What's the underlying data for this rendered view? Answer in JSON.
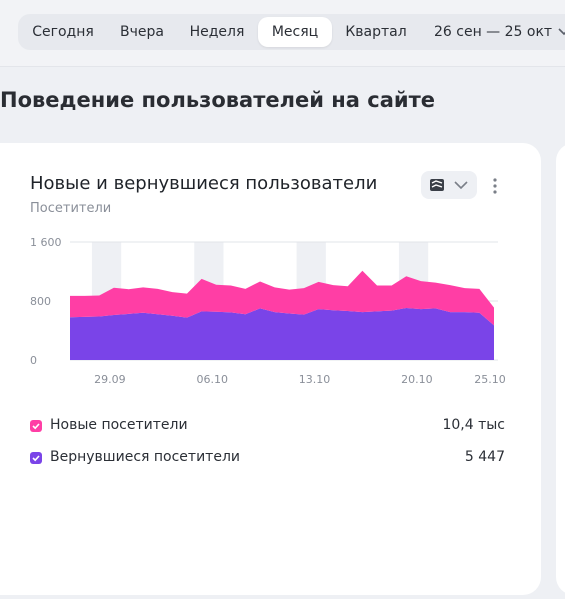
{
  "periods": [
    {
      "label": "Сегодня",
      "active": false
    },
    {
      "label": "Вчера",
      "active": false
    },
    {
      "label": "Неделя",
      "active": false
    },
    {
      "label": "Месяц",
      "active": true
    },
    {
      "label": "Квартал",
      "active": false
    }
  ],
  "date_range": "26 сен — 25 окт",
  "section_title": "Поведение пользователей на сайте",
  "card": {
    "title": "Новые и вернувшиеся пользователи",
    "subtitle": "Посетители",
    "chart_type_icon": "stacked-area-icon",
    "more_icon": "more-vertical-icon"
  },
  "legend": [
    {
      "label": "Новые посетители",
      "value": "10,4 тыс",
      "color": "#ff3ea5"
    },
    {
      "label": "Вернувшиеся посетители",
      "value": "5 447",
      "color": "#7a44e8"
    }
  ],
  "chart_data": {
    "type": "area",
    "stacked": true,
    "x": [
      "26.09",
      "27.09",
      "28.09",
      "29.09",
      "30.09",
      "01.10",
      "02.10",
      "03.10",
      "04.10",
      "05.10",
      "06.10",
      "07.10",
      "08.10",
      "09.10",
      "10.10",
      "11.10",
      "12.10",
      "13.10",
      "14.10",
      "15.10",
      "16.10",
      "17.10",
      "18.10",
      "19.10",
      "20.10",
      "21.10",
      "22.10",
      "23.10",
      "24.10",
      "25.10"
    ],
    "x_ticks": [
      "29.09",
      "06.10",
      "13.10",
      "20.10",
      "25.10"
    ],
    "y_ticks": [
      "0",
      "800",
      "1 600"
    ],
    "ylim": [
      0,
      1600
    ],
    "weekend_bands": [
      [
        "28.09",
        "29.09"
      ],
      [
        "05.10",
        "06.10"
      ],
      [
        "12.10",
        "13.10"
      ],
      [
        "19.10",
        "20.10"
      ]
    ],
    "grid": true,
    "series": [
      {
        "name": "Вернувшиеся посетители",
        "color": "#7a44e8",
        "values": [
          580,
          585,
          590,
          610,
          625,
          640,
          620,
          600,
          575,
          660,
          655,
          645,
          620,
          700,
          650,
          630,
          615,
          690,
          675,
          665,
          650,
          660,
          670,
          705,
          690,
          700,
          650,
          650,
          640,
          470
        ]
      },
      {
        "name": "Новые посетители",
        "color": "#ff3ea5",
        "values": [
          290,
          285,
          285,
          370,
          335,
          345,
          345,
          320,
          325,
          440,
          365,
          365,
          345,
          365,
          335,
          325,
          360,
          370,
          340,
          335,
          560,
          350,
          340,
          430,
          380,
          350,
          365,
          325,
          325,
          240
        ]
      }
    ]
  }
}
